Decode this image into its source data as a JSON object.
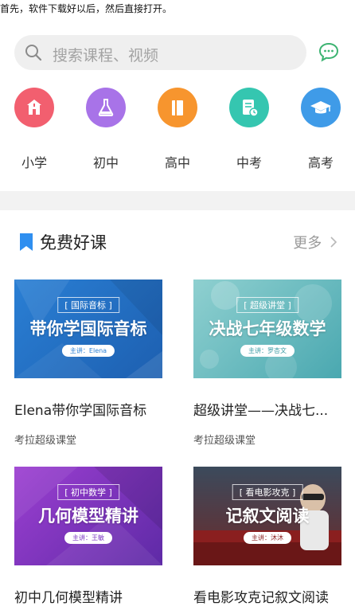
{
  "caption": "首先，软件下载好以后，然后直接打开。",
  "search": {
    "placeholder": "搜索课程、视频"
  },
  "icons": {
    "search": "search-icon",
    "message": "chat-bubble-icon"
  },
  "categories": [
    {
      "label": "小学",
      "icon": "school-building-icon",
      "color": "#f25f6f"
    },
    {
      "label": "初中",
      "icon": "flask-icon",
      "color": "#a873e8"
    },
    {
      "label": "高中",
      "icon": "book-icon",
      "color": "#f7952e"
    },
    {
      "label": "中考",
      "icon": "exam-paper-icon",
      "color": "#35c6b0"
    },
    {
      "label": "高考",
      "icon": "graduation-cap-icon",
      "color": "#3f9be8"
    }
  ],
  "section": {
    "title": "免费好课",
    "more": "更多"
  },
  "courses": [
    {
      "tag": "[ 国际音标 ]",
      "headline": "带你学国际音标",
      "teacher": "主讲：Elena",
      "title": "Elena带你学国际音标",
      "provider": "考拉超级课堂"
    },
    {
      "tag": "[ 超级讲堂 ]",
      "headline": "决战七年级数学",
      "teacher": "主讲：罗杏文",
      "title": "超级讲堂——决战七...",
      "provider": "考拉超级课堂"
    },
    {
      "tag": "[ 初中数学 ]",
      "headline": "几何模型精讲",
      "teacher": "主讲：王敏",
      "title": "初中几何模型精讲",
      "provider": ""
    },
    {
      "tag": "[ 看电影攻克 ]",
      "headline": "记叙文阅读",
      "teacher": "主讲：沐沐",
      "title": "看电影攻克记叙文阅读",
      "provider": ""
    }
  ]
}
